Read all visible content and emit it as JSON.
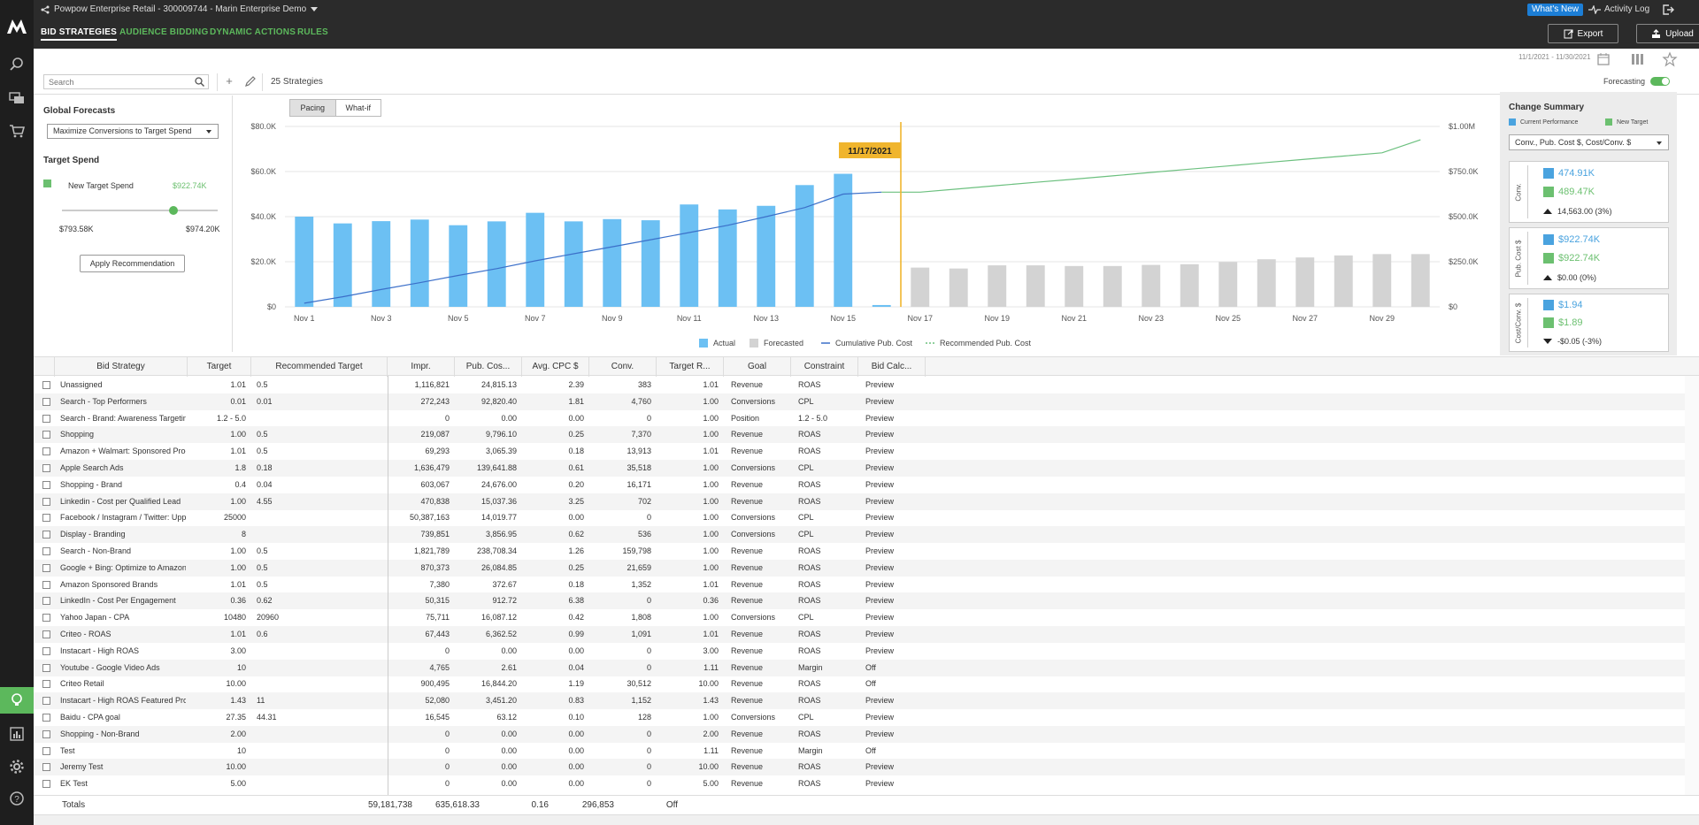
{
  "topbar": {
    "account": "Powpow Enterprise Retail - 300009744 - Marin Enterprise Demo",
    "whats_new": "What's New",
    "activity_log": "Activity Log"
  },
  "nav": {
    "tabs": [
      "BID STRATEGIES",
      "AUDIENCE BIDDING",
      "DYNAMIC ACTIONS",
      "RULES"
    ],
    "export": "Export",
    "upload": "Upload"
  },
  "date_range": "11/1/2021 - 11/30/2021",
  "toolbar": {
    "search_placeholder": "Search",
    "strategy_count": "25 Strategies",
    "forecasting": "Forecasting"
  },
  "global_forecasts": {
    "title": "Global Forecasts",
    "objective": "Maximize Conversions to Target Spend",
    "target_spend_title": "Target Spend",
    "new_target_label": "New Target Spend",
    "new_target_value": "$922.74K",
    "slider_min": "$793.58K",
    "slider_max": "$974.20K",
    "slider_position": 0.714,
    "apply": "Apply Recommendation"
  },
  "chart_toggle": {
    "pacing": "Pacing",
    "whatif": "What-if"
  },
  "chart_data": {
    "type": "bar",
    "categories": [
      "Nov 1",
      "Nov 2",
      "Nov 3",
      "Nov 4",
      "Nov 5",
      "Nov 6",
      "Nov 7",
      "Nov 8",
      "Nov 9",
      "Nov 10",
      "Nov 11",
      "Nov 12",
      "Nov 13",
      "Nov 14",
      "Nov 15",
      "Nov 16",
      "Nov 17",
      "Nov 18",
      "Nov 19",
      "Nov 20",
      "Nov 21",
      "Nov 22",
      "Nov 23",
      "Nov 24",
      "Nov 25",
      "Nov 26",
      "Nov 27",
      "Nov 28",
      "Nov 29",
      "Nov 30"
    ],
    "x_tick_labels": [
      "Nov 1",
      "Nov 3",
      "Nov 5",
      "Nov 7",
      "Nov 9",
      "Nov 11",
      "Nov 13",
      "Nov 15",
      "Nov 17",
      "Nov 19",
      "Nov 21",
      "Nov 23",
      "Nov 25",
      "Nov 27",
      "Nov 29"
    ],
    "series": [
      {
        "name": "Actual",
        "color": "#6cc0f3",
        "values": [
          40000,
          37000,
          38000,
          38700,
          36200,
          37900,
          41700,
          37900,
          38900,
          38400,
          45400,
          43200,
          44800,
          54000,
          59000,
          800,
          null,
          null,
          null,
          null,
          null,
          null,
          null,
          null,
          null,
          null,
          null,
          null,
          null,
          null
        ]
      },
      {
        "name": "Forecasted",
        "color": "#d3d3d3",
        "values": [
          null,
          null,
          null,
          null,
          null,
          null,
          null,
          null,
          null,
          null,
          null,
          null,
          null,
          null,
          null,
          null,
          17400,
          17000,
          18400,
          18400,
          18100,
          18100,
          18600,
          18900,
          19900,
          21100,
          21900,
          22800,
          23400,
          23400
        ]
      },
      {
        "name": "Cumulative Pub. Cost",
        "axis": "right",
        "color": "#3b6fc9",
        "values": [
          20000,
          56000,
          96000,
          134000,
          174000,
          212000,
          255000,
          294000,
          333000,
          372000,
          412000,
          452000,
          500000,
          550000,
          625000,
          636000,
          null,
          null,
          null,
          null,
          null,
          null,
          null,
          null,
          null,
          null,
          null,
          null,
          null,
          null
        ]
      },
      {
        "name": "Recommended Pub. Cost",
        "axis": "right",
        "color": "#6cc07f",
        "values": [
          null,
          null,
          null,
          null,
          null,
          null,
          null,
          null,
          null,
          null,
          null,
          null,
          null,
          null,
          null,
          636000,
          636000,
          654000,
          672000,
          690000,
          708000,
          726000,
          745000,
          763000,
          781000,
          800000,
          818000,
          836000,
          854000,
          926000
        ]
      }
    ],
    "y_ticks_left": [
      "$0",
      "$20.0K",
      "$40.0K",
      "$60.0K",
      "$80.0K"
    ],
    "y_ticks_right": [
      "$0",
      "$250.0K",
      "$500.0K",
      "$750.0K",
      "$1.00M"
    ],
    "ylim_left": [
      0,
      80000
    ],
    "ylim_right": [
      0,
      1000000
    ],
    "marker_label": "11/17/2021",
    "marker_index": 16,
    "marker_color": "#f0b52e",
    "legend": [
      "Actual",
      "Forecasted",
      "Cumulative Pub. Cost",
      "Recommended Pub. Cost"
    ],
    "legend_position": "bottom"
  },
  "change_summary": {
    "title": "Change Summary",
    "legend_current": "Current Performance",
    "legend_new": "New Target",
    "metrics_select": "Conv., Pub. Cost $, Cost/Conv. $",
    "cards": [
      {
        "label": "Conv.",
        "current": "474.91K",
        "new": "489.47K",
        "delta": "14,563.00 (3%)",
        "direction": "up"
      },
      {
        "label": "Pub. Cost $",
        "current": "$922.74K",
        "new": "$922.74K",
        "delta": "$0.00 (0%)",
        "direction": "up"
      },
      {
        "label": "Cost/Conv. $",
        "current": "$1.94",
        "new": "$1.89",
        "delta": "-$0.05 (-3%)",
        "direction": "down"
      }
    ],
    "color_current": "#4aa3df",
    "color_new": "#6cc070"
  },
  "table": {
    "columns": [
      "Bid Strategy",
      "Target",
      "Recommended Target",
      "Impr.",
      "Pub. Cos...",
      "Avg. CPC $",
      "Conv.",
      "Target R...",
      "Goal",
      "Constraint",
      "Bid Calc..."
    ],
    "rows": [
      [
        "Unassigned",
        "1.01",
        "0.5",
        "1,116,821",
        "24,815.13",
        "2.39",
        "383",
        "1.01",
        "Revenue",
        "ROAS",
        "Preview"
      ],
      [
        "Search - Top Performers",
        "0.01",
        "0.01",
        "272,243",
        "92,820.40",
        "1.81",
        "4,760",
        "1.00",
        "Conversions",
        "CPL",
        "Preview"
      ],
      [
        "Search - Brand: Awareness Targeting",
        "1.2 - 5.0",
        "",
        "0",
        "0.00",
        "0.00",
        "0",
        "1.00",
        "Position",
        "1.2 - 5.0",
        "Preview"
      ],
      [
        "Shopping",
        "1.00",
        "0.5",
        "219,087",
        "9,796.10",
        "0.25",
        "7,370",
        "1.00",
        "Revenue",
        "ROAS",
        "Preview"
      ],
      [
        "Amazon + Walmart: Sponsored Products",
        "1.01",
        "0.5",
        "69,293",
        "3,065.39",
        "0.18",
        "13,913",
        "1.01",
        "Revenue",
        "ROAS",
        "Preview"
      ],
      [
        "Apple Search Ads",
        "1.8",
        "0.18",
        "1,636,479",
        "139,641.88",
        "0.61",
        "35,518",
        "1.00",
        "Conversions",
        "CPL",
        "Preview"
      ],
      [
        "Shopping - Brand",
        "0.4",
        "0.04",
        "603,067",
        "24,676.00",
        "0.20",
        "16,171",
        "1.00",
        "Revenue",
        "ROAS",
        "Preview"
      ],
      [
        "Linkedin - Cost per Qualified Lead",
        "1.00",
        "4.55",
        "470,838",
        "15,037.36",
        "3.25",
        "702",
        "1.00",
        "Revenue",
        "ROAS",
        "Preview"
      ],
      [
        "Facebook / Instagram / Twitter: Upper",
        "25000",
        "",
        "50,387,163",
        "14,019.77",
        "0.00",
        "0",
        "1.00",
        "Conversions",
        "CPL",
        "Preview"
      ],
      [
        "Display - Branding",
        "8",
        "",
        "739,851",
        "3,856.95",
        "0.62",
        "536",
        "1.00",
        "Conversions",
        "CPL",
        "Preview"
      ],
      [
        "Search - Non-Brand",
        "1.00",
        "0.5",
        "1,821,789",
        "238,708.34",
        "1.26",
        "159,798",
        "1.00",
        "Revenue",
        "ROAS",
        "Preview"
      ],
      [
        "Google + Bing: Optimize to Amazon",
        "1.00",
        "0.5",
        "870,373",
        "26,084.85",
        "0.25",
        "21,659",
        "1.00",
        "Revenue",
        "ROAS",
        "Preview"
      ],
      [
        "Amazon Sponsored Brands",
        "1.01",
        "0.5",
        "7,380",
        "372.67",
        "0.18",
        "1,352",
        "1.01",
        "Revenue",
        "ROAS",
        "Preview"
      ],
      [
        "LinkedIn - Cost Per Engagement",
        "0.36",
        "0.62",
        "50,315",
        "912.72",
        "6.38",
        "0",
        "0.36",
        "Revenue",
        "ROAS",
        "Preview"
      ],
      [
        "Yahoo Japan - CPA",
        "10480",
        "20960",
        "75,711",
        "16,087.12",
        "0.42",
        "1,808",
        "1.00",
        "Conversions",
        "CPL",
        "Preview"
      ],
      [
        "Criteo - ROAS",
        "1.01",
        "0.6",
        "67,443",
        "6,362.52",
        "0.99",
        "1,091",
        "1.01",
        "Revenue",
        "ROAS",
        "Preview"
      ],
      [
        "Instacart - High ROAS",
        "3.00",
        "",
        "0",
        "0.00",
        "0.00",
        "0",
        "3.00",
        "Revenue",
        "ROAS",
        "Preview"
      ],
      [
        "Youtube - Google Video Ads",
        "10",
        "",
        "4,765",
        "2.61",
        "0.04",
        "0",
        "1.11",
        "Revenue",
        "Margin",
        "Off"
      ],
      [
        "Criteo Retail",
        "10.00",
        "",
        "900,495",
        "16,844.20",
        "1.19",
        "30,512",
        "10.00",
        "Revenue",
        "ROAS",
        "Off"
      ],
      [
        "Instacart - High ROAS Featured Products",
        "1.43",
        "11",
        "52,080",
        "3,451.20",
        "0.83",
        "1,152",
        "1.43",
        "Revenue",
        "ROAS",
        "Preview"
      ],
      [
        "Baidu - CPA goal",
        "27.35",
        "44.31",
        "16,545",
        "63.12",
        "0.10",
        "128",
        "1.00",
        "Conversions",
        "CPL",
        "Preview"
      ],
      [
        "Shopping - Non-Brand",
        "2.00",
        "",
        "0",
        "0.00",
        "0.00",
        "0",
        "2.00",
        "Revenue",
        "ROAS",
        "Preview"
      ],
      [
        "Test",
        "10",
        "",
        "0",
        "0.00",
        "0.00",
        "0",
        "1.11",
        "Revenue",
        "Margin",
        "Off"
      ],
      [
        "Jeremy Test",
        "10.00",
        "",
        "0",
        "0.00",
        "0.00",
        "0",
        "10.00",
        "Revenue",
        "ROAS",
        "Preview"
      ],
      [
        "EK Test",
        "5.00",
        "",
        "0",
        "0.00",
        "0.00",
        "0",
        "5.00",
        "Revenue",
        "ROAS",
        "Preview"
      ]
    ],
    "totals": {
      "label": "Totals",
      "impr": "59,181,738",
      "pub_cost": "635,618.33",
      "avg_cpc": "0.16",
      "conv": "296,853",
      "target_r": "Off"
    }
  }
}
